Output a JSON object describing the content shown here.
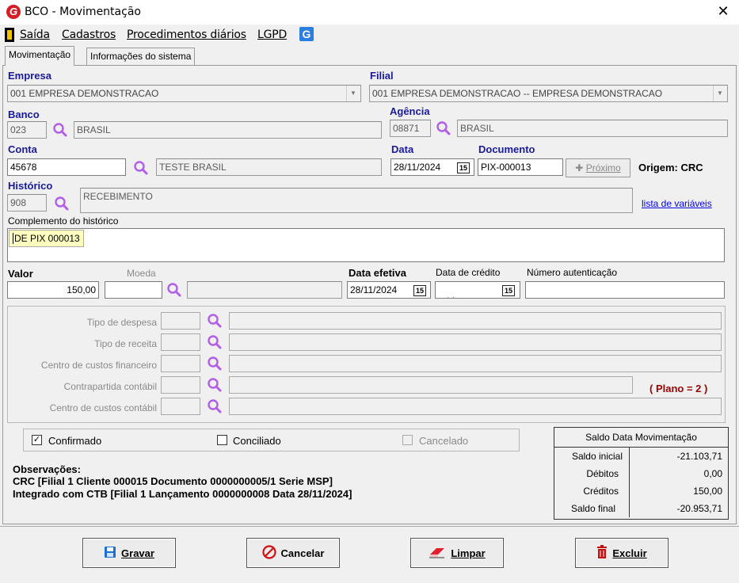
{
  "window": {
    "title": "BCO - Movimentação",
    "close_glyph": "✕",
    "logo_letter": "G"
  },
  "menu": {
    "items": [
      "Saída",
      "Cadastros",
      "Procedimentos diários",
      "LGPD"
    ],
    "icon_letter": "G"
  },
  "tabs": [
    "Movimentação",
    "Informações do sistema"
  ],
  "empresa": {
    "label": "Empresa",
    "value": "001 EMPRESA DEMONSTRACAO"
  },
  "filial": {
    "label": "Filial",
    "value": "001 EMPRESA DEMONSTRACAO -- EMPRESA DEMONSTRACAO"
  },
  "banco": {
    "label": "Banco",
    "code": "023",
    "name": "BRASIL"
  },
  "agencia": {
    "label": "Agência",
    "code": "08871",
    "name": "BRASIL"
  },
  "conta": {
    "label": "Conta",
    "code": "45678",
    "name": "TESTE BRASIL"
  },
  "data": {
    "label": "Data",
    "value": "28/11/2024"
  },
  "documento": {
    "label": "Documento",
    "value": "PIX-000013"
  },
  "proximo": {
    "label": "Próximo",
    "icon": "✚"
  },
  "origem": "Origem: CRC",
  "historico": {
    "label": "Histórico",
    "code": "908",
    "name": "RECEBIMENTO"
  },
  "lista_variaveis": "lista de variáveis",
  "complemento": {
    "label": "Complemento do histórico",
    "value": "DE PIX 000013"
  },
  "valor": {
    "label": "Valor",
    "value": "150,00"
  },
  "moeda": {
    "label": "Moeda",
    "code": "",
    "name": ""
  },
  "data_efetiva": {
    "label": "Data efetiva",
    "value": "28/11/2024"
  },
  "data_credito": {
    "label": "Data de crédito",
    "value": " / /"
  },
  "numero_autenticacao": {
    "label": "Número autenticação",
    "value": ""
  },
  "calendar_glyph": "15",
  "classificacao": {
    "rows": [
      {
        "label": "Tipo de despesa"
      },
      {
        "label": "Tipo de receita"
      },
      {
        "label": "Centro de custos financeiro"
      },
      {
        "label": "Contrapartida contábil"
      },
      {
        "label": "Centro de custos contábil"
      }
    ],
    "plano": "( Plano = 2 )"
  },
  "status": {
    "confirmado": {
      "label": "Confirmado",
      "checked": true,
      "mark": "✓"
    },
    "conciliado": {
      "label": "Conciliado",
      "checked": false
    },
    "cancelado": {
      "label": "Cancelado",
      "checked": false
    }
  },
  "observacoes": {
    "title": "Observações:",
    "lines": [
      "CRC [Filial 1 Cliente 000015 Documento 0000000005/1 Serie MSP]",
      "Integrado com CTB [Filial 1 Lançamento 0000000008 Data 28/11/2024]"
    ]
  },
  "saldo": {
    "title": "Saldo Data Movimentação",
    "rows": [
      {
        "label": "Saldo inicial",
        "value": "-21.103,71"
      },
      {
        "label": "Débitos",
        "value": "0,00"
      },
      {
        "label": "Créditos",
        "value": "150,00"
      },
      {
        "label": "Saldo final",
        "value": "-20.953,71"
      }
    ]
  },
  "buttons": {
    "gravar": "Gravar",
    "cancelar": "Cancelar",
    "limpar": "Limpar",
    "excluir": "Excluir"
  },
  "colors": {
    "label_blue": "#1a1a9c",
    "accent_magenta": "#b25ee8",
    "plano_red": "#9a0000",
    "tooltip_yellow": "#ffffc0"
  }
}
